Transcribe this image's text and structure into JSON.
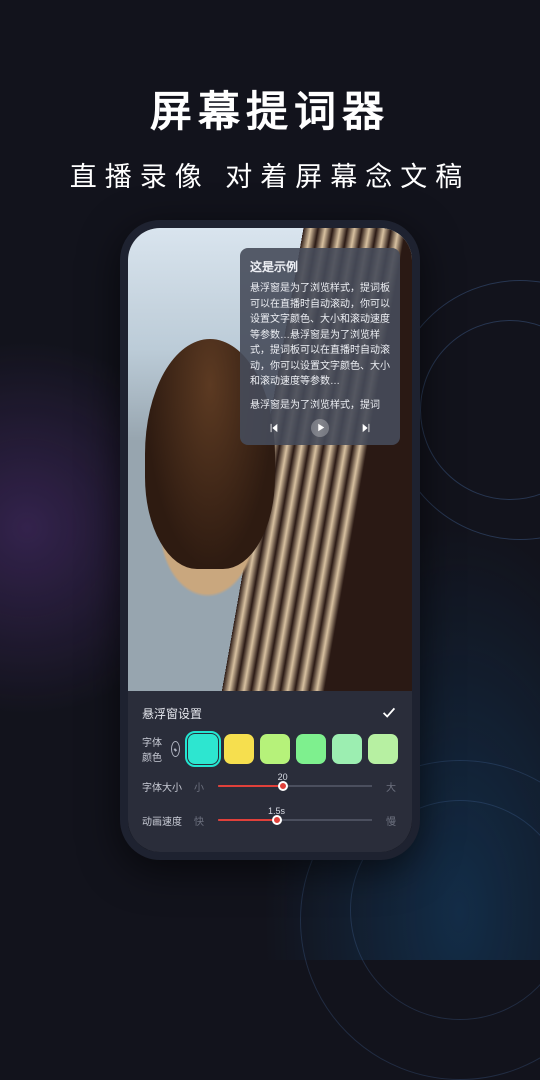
{
  "hero": {
    "title": "屏幕提词器",
    "subtitle": "直播录像 对着屏幕念文稿"
  },
  "floatPanel": {
    "title": "这是示例",
    "body": "悬浮窗是为了浏览样式，提词板可以在直播时自动滚动，你可以设置文字颜色、大小和滚动速度等参数…悬浮窗是为了浏览样式，提词板可以在直播时自动滚动，你可以设置文字颜色、大小和滚动速度等参数…",
    "tail": "悬浮窗是为了浏览样式，提词"
  },
  "settings": {
    "title": "悬浮窗设置",
    "colorLabel": "字体颜色",
    "swatches": [
      {
        "color": "#2de6d0",
        "selected": true
      },
      {
        "color": "#f6df4e",
        "selected": false
      },
      {
        "color": "#b6f27a",
        "selected": false
      },
      {
        "color": "#7ef08e",
        "selected": false
      },
      {
        "color": "#9ceeb1",
        "selected": false
      },
      {
        "color": "#b7f0a2",
        "selected": false
      }
    ],
    "fontSize": {
      "label": "字体大小",
      "leftLabel": "小",
      "rightLabel": "大",
      "value": "20",
      "percent": 42
    },
    "speed": {
      "label": "动画速度",
      "leftLabel": "快",
      "rightLabel": "慢",
      "value": "1.5s",
      "percent": 38
    }
  }
}
